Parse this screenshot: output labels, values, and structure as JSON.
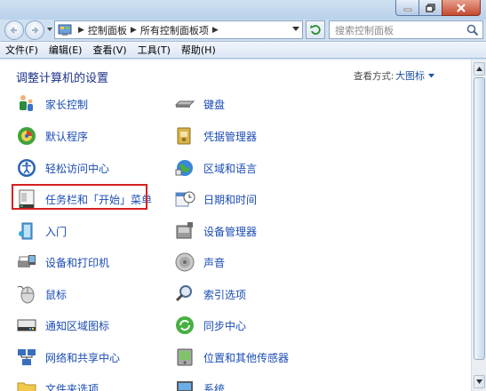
{
  "address": {
    "breadcrumb": [
      "控制面板",
      "所有控制面板项"
    ],
    "search_placeholder": "搜索控制面板"
  },
  "menu": [
    "文件(F)",
    "编辑(E)",
    "查看(V)",
    "工具(T)",
    "帮助(H)"
  ],
  "page": {
    "title": "调整计算机的设置",
    "view_label": "查看方式:",
    "view_value": "大图标"
  },
  "items_left": [
    {
      "label": "家长控制",
      "icon": "parental-controls-icon"
    },
    {
      "label": "默认程序",
      "icon": "default-programs-icon"
    },
    {
      "label": "轻松访问中心",
      "icon": "ease-of-access-icon"
    },
    {
      "label": "任务栏和「开始」菜单",
      "icon": "taskbar-start-menu-icon"
    },
    {
      "label": "入门",
      "icon": "getting-started-icon"
    },
    {
      "label": "设备和打印机",
      "icon": "devices-printers-icon"
    },
    {
      "label": "鼠标",
      "icon": "mouse-icon"
    },
    {
      "label": "通知区域图标",
      "icon": "notification-area-icon"
    },
    {
      "label": "网络和共享中心",
      "icon": "network-sharing-icon"
    },
    {
      "label": "文件夹选项",
      "icon": "folder-options-icon"
    }
  ],
  "items_right": [
    {
      "label": "键盘",
      "icon": "keyboard-icon"
    },
    {
      "label": "凭据管理器",
      "icon": "credential-manager-icon"
    },
    {
      "label": "区域和语言",
      "icon": "region-language-icon"
    },
    {
      "label": "日期和时间",
      "icon": "date-time-icon"
    },
    {
      "label": "设备管理器",
      "icon": "device-manager-icon"
    },
    {
      "label": "声音",
      "icon": "sound-icon"
    },
    {
      "label": "索引选项",
      "icon": "indexing-options-icon"
    },
    {
      "label": "同步中心",
      "icon": "sync-center-icon"
    },
    {
      "label": "位置和其他传感器",
      "icon": "location-sensors-icon"
    },
    {
      "label": "系统",
      "icon": "system-icon"
    }
  ],
  "colors": {
    "link": "#1a4cb4",
    "title": "#1e3287",
    "highlight": "#d62020"
  }
}
